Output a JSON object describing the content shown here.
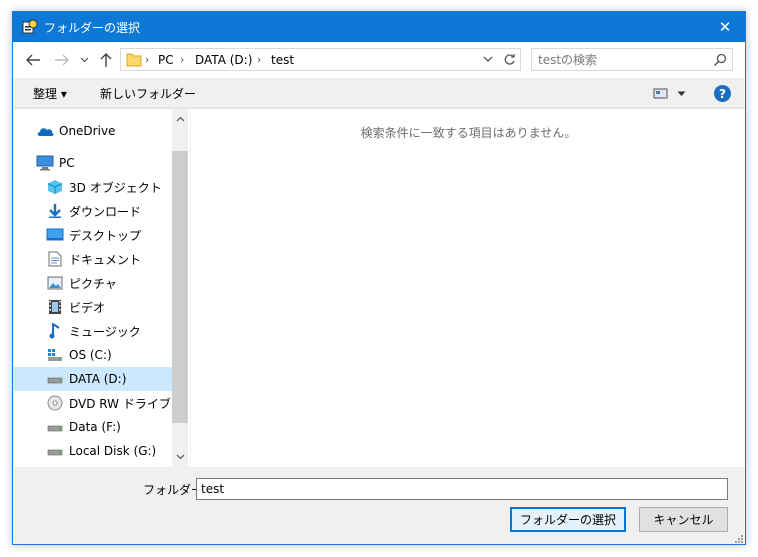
{
  "window": {
    "title": "フォルダーの選択",
    "close_glyph": "✕"
  },
  "address": {
    "crumbs": [
      "PC",
      "DATA (D:)",
      "test"
    ]
  },
  "search": {
    "placeholder": "testの検索"
  },
  "toolbar": {
    "organize_label": "整理 ▾",
    "new_folder_label": "新しいフォルダー",
    "help_glyph": "?"
  },
  "nav": {
    "items": [
      {
        "label": "OneDrive",
        "icon": "onedrive-icon"
      },
      {
        "label": "PC",
        "icon": "pc-icon"
      },
      {
        "label": "3D オブジェクト",
        "icon": "3d-objects-icon"
      },
      {
        "label": "ダウンロード",
        "icon": "download-icon"
      },
      {
        "label": "デスクトップ",
        "icon": "desktop-icon"
      },
      {
        "label": "ドキュメント",
        "icon": "documents-icon"
      },
      {
        "label": "ピクチャ",
        "icon": "pictures-icon"
      },
      {
        "label": "ビデオ",
        "icon": "videos-icon"
      },
      {
        "label": "ミュージック",
        "icon": "music-icon"
      },
      {
        "label": "OS (C:)",
        "icon": "os-drive-icon"
      },
      {
        "label": "DATA (D:)",
        "icon": "drive-icon",
        "selected": true
      },
      {
        "label": "DVD RW ドライブ (E:)",
        "icon": "dvd-drive-icon"
      },
      {
        "label": "Data (F:)",
        "icon": "drive-icon"
      },
      {
        "label": "Local Disk (G:)",
        "icon": "drive-icon"
      }
    ]
  },
  "main": {
    "empty_message": "検索条件に一致する項目はありません。"
  },
  "footer": {
    "folder_label": "フォルダー:",
    "folder_value": "test",
    "select_button": "フォルダーの選択",
    "cancel_button": "キャンセル"
  },
  "colors": {
    "titlebar": "#0e78d7",
    "selection": "#cce8ff",
    "accent": "#0078d7"
  }
}
